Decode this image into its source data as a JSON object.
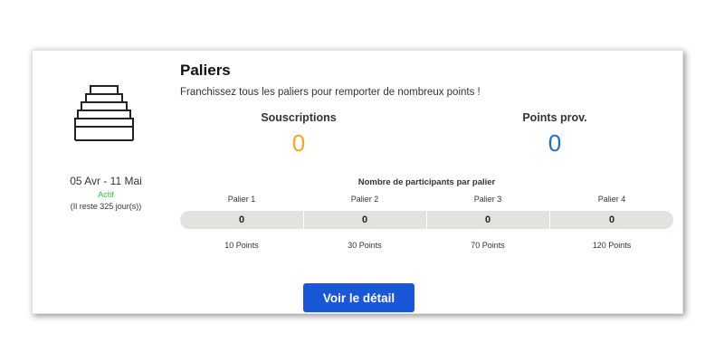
{
  "card": {
    "icon": "stairs-icon",
    "date_range": "05 Avr - 11 Mai",
    "status": "Actif",
    "remaining": "(Il reste 325 jour(s))",
    "title": "Paliers",
    "subtitle": "Franchissez tous les paliers pour remporter de nombreux points !",
    "stats": [
      {
        "label": "Souscriptions",
        "value": "0",
        "color": "#f5a623"
      },
      {
        "label": "Points prov.",
        "value": "0",
        "color": "#1a6fd8"
      }
    ],
    "participants_label": "Nombre de participants par palier",
    "tiers": [
      {
        "name": "Palier 1",
        "count": "0",
        "points": "10 Points"
      },
      {
        "name": "Palier 2",
        "count": "0",
        "points": "30 Points"
      },
      {
        "name": "Palier 3",
        "count": "0",
        "points": "70 Points"
      },
      {
        "name": "Palier 4",
        "count": "0",
        "points": "120 Points"
      }
    ],
    "detail_button": "Voir le détail"
  },
  "colors": {
    "status_active": "#22cc33",
    "button_bg": "#1a57d8",
    "bar_bg": "#e3e2de"
  }
}
